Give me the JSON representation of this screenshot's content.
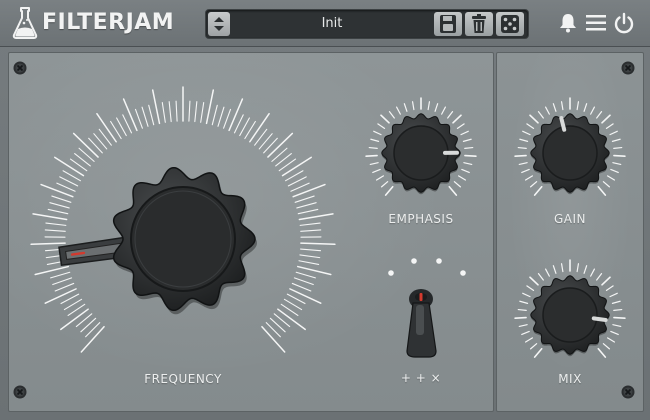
{
  "header": {
    "title": "FILTERJAM",
    "preset_name": "Init"
  },
  "controls": {
    "frequency": {
      "label": "FREQUENCY",
      "value": 0.15
    },
    "emphasis": {
      "label": "EMPHASIS",
      "value": 0.82
    },
    "gain": {
      "label": "GAIN",
      "value": 0.45
    },
    "mix": {
      "label": "MIX",
      "value": 0.85
    },
    "mode_switch": {
      "label": "+ + ×",
      "positions": 4,
      "selected": 2
    }
  },
  "icons": {
    "logo": "flask-icon",
    "preset_stepper": "chevron-updown-icon",
    "save": "floppy-disk-icon",
    "delete": "trash-icon",
    "randomize": "dice-icon",
    "notifications": "bell-icon",
    "menu": "hamburger-icon",
    "power": "power-icon"
  },
  "colors": {
    "panel": "#8a9193",
    "knob": "#2a2c2d",
    "tick": "#f4f5f5",
    "pointer": "#d8dada",
    "accent_red": "#d23a2e"
  }
}
